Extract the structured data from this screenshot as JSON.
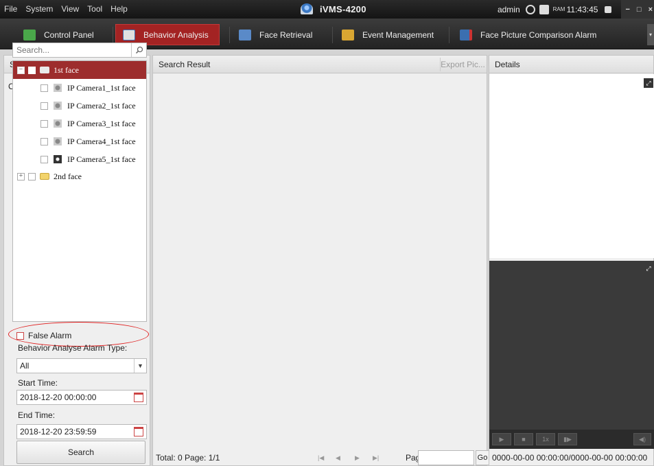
{
  "titlebar": {
    "menu": [
      "File",
      "System",
      "View",
      "Tool",
      "Help"
    ],
    "app_name": "iVMS-4200",
    "user": "admin",
    "ram_label": "RAM",
    "time": "11:43:45"
  },
  "tabs": [
    {
      "label": "Control Panel",
      "icon": "grid-icon",
      "color": "#4aa84a"
    },
    {
      "label": "Behavior Analysis",
      "icon": "behavior-icon",
      "color": "#3b6fb0"
    },
    {
      "label": "Face Retrieval",
      "icon": "face-retrieval-icon",
      "color": "#3b6fb0"
    },
    {
      "label": "Event Management",
      "icon": "event-icon",
      "color": "#d9a632"
    },
    {
      "label": "Face Picture Comparison Alarm",
      "icon": "face-compare-icon",
      "color": "#3b6fb0"
    }
  ],
  "search_condition": {
    "title": "Search Condition",
    "camera_label": "Camera",
    "search_placeholder": "Search...",
    "tree": {
      "root": "1st face",
      "cameras": [
        "IP Camera1_1st face",
        "IP Camera2_1st face",
        "IP Camera3_1st face",
        "IP Camera4_1st face",
        "IP Camera5_1st face"
      ],
      "group2": "2nd face"
    },
    "false_alarm": "False Alarm",
    "alarm_type_label": "Behavior Analyse Alarm Type:",
    "alarm_type_value": "All",
    "start_label": "Start Time:",
    "start_value": "2018-12-20 00:00:00",
    "end_label": "End Time:",
    "end_value": "2018-12-20 23:59:59",
    "search_button": "Search"
  },
  "search_result": {
    "title": "Search Result",
    "export_button": "Export Pic...",
    "pager_total": "Total: 0  Page: 1/1",
    "page_label": "Page",
    "go_label": "Go"
  },
  "details": {
    "title": "Details",
    "speed": "1x",
    "time_range": "0000-00-00 00:00:00/0000-00-00 00:00:00"
  },
  "colors": {
    "accent": "#a32323",
    "selection": "#9d2d2d",
    "annotation": "#e02020"
  }
}
